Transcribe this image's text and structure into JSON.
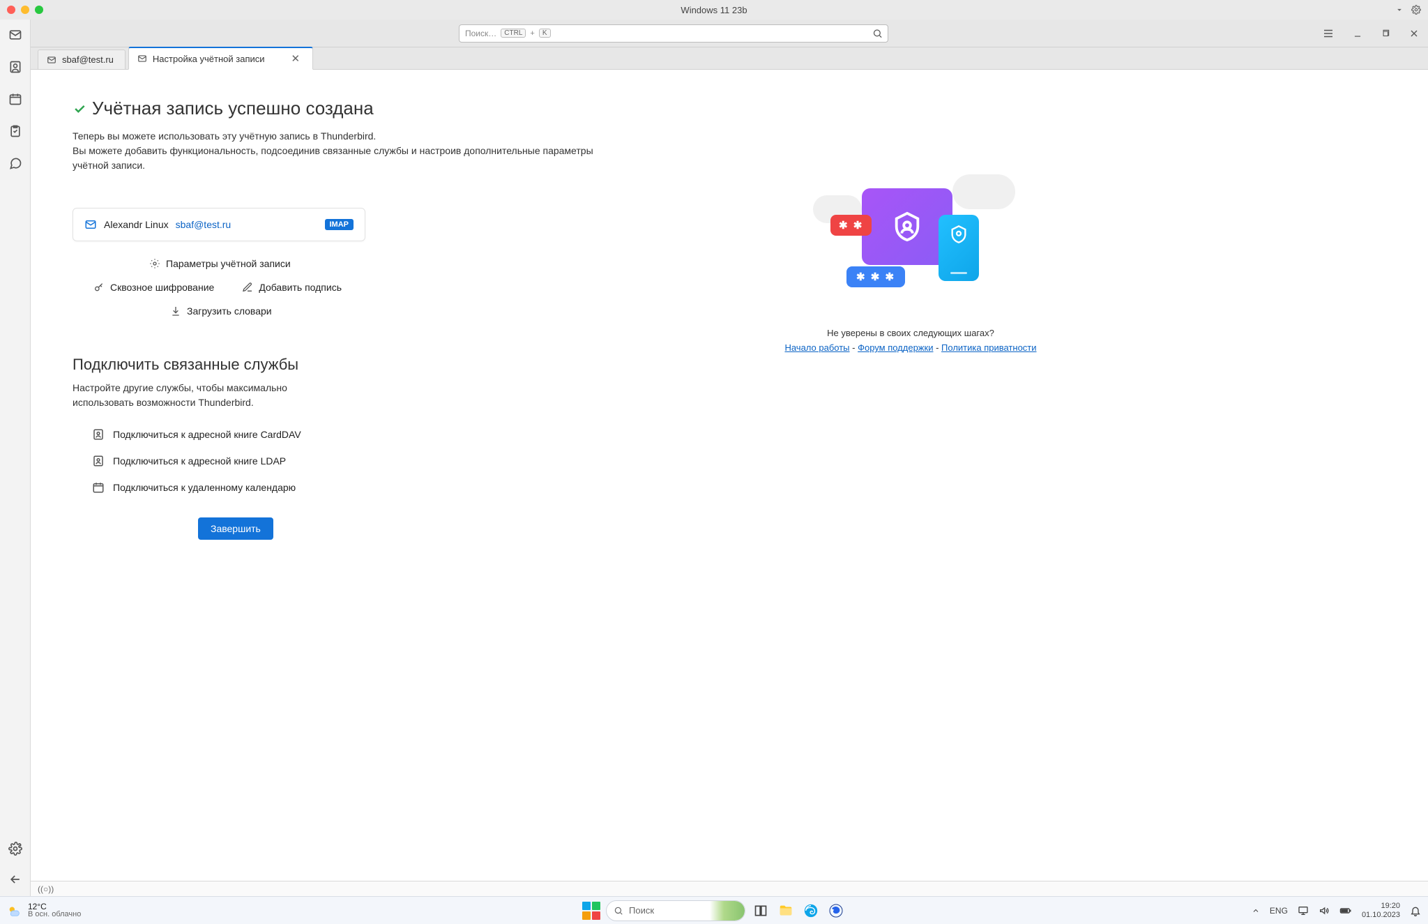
{
  "titlebar": {
    "title": "Windows 11 23b"
  },
  "toolbar": {
    "search_placeholder": "Поиск…",
    "kbd1": "CTRL",
    "kbd_plus": "+",
    "kbd2": "K"
  },
  "tabs": {
    "tab1_label": "sbaf@test.ru",
    "tab2_label": "Настройка учётной записи"
  },
  "content": {
    "heading": "Учётная запись успешно создана",
    "sub_line1": "Теперь вы можете использовать эту учётную запись в Thunderbird.",
    "sub_line2": "Вы можете добавить функциональность, подсоединив связанные службы и настроив дополнительные параметры учётной записи.",
    "account": {
      "name": "Alexandr Linux",
      "email": "sbaf@test.ru",
      "badge": "IMAP"
    },
    "actions": {
      "settings": "Параметры учётной записи",
      "e2e": "Сквозное шифрование",
      "signature": "Добавить подпись",
      "dictionaries": "Загрузить словари"
    },
    "services": {
      "heading": "Подключить связанные службы",
      "desc": "Настройте другие службы, чтобы максимально использовать возможности Thunderbird.",
      "carddav": "Подключиться к адресной книге CardDAV",
      "ldap": "Подключиться к адресной книге LDAP",
      "calendar": "Подключиться к удаленному календарю"
    },
    "finish": "Завершить",
    "right": {
      "unsure": "Не уверены в своих следующих шагах?",
      "link1": "Начало работы",
      "link2": "Форум поддержки",
      "link3": "Политика приватности",
      "sep": " - "
    },
    "asterisks": "✱ ✱",
    "asterisks3": "✱ ✱ ✱"
  },
  "taskbar": {
    "temp": "12°C",
    "weather": "В осн. облачно",
    "search": "Поиск",
    "lang": "ENG",
    "time": "19:20",
    "date": "01.10.2023"
  }
}
